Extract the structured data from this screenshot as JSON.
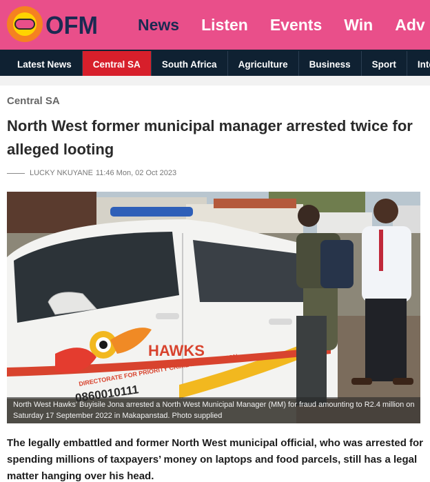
{
  "brand": {
    "logo_text": "OFM",
    "colors": {
      "header_pink": "#e94f8a",
      "nav_dark": "#0f2132",
      "active_red": "#d71f2b",
      "logo_orange": "#f58220"
    }
  },
  "top_nav": {
    "items": [
      "News",
      "Listen",
      "Events",
      "Win",
      "Adv"
    ],
    "active": "News"
  },
  "category_nav": {
    "items": [
      "Latest News",
      "Central SA",
      "South Africa",
      "Agriculture",
      "Business",
      "Sport",
      "Intern"
    ],
    "active": "Central SA"
  },
  "article": {
    "section": "Central SA",
    "title": "North West former municipal manager arrested twice for alleged looting",
    "author": "LUCKY NKUYANE",
    "timestamp": "11:46 Mon, 02 Oct 2023",
    "image": {
      "vehicle_text": "HAWKS",
      "vehicle_subtext": "DIRECTORATE FOR PRIORITY CRIME INVESTIGATION",
      "vehicle_phone": "0860010111",
      "caption": "North West Hawks' Buyisile Jona arrested a North West Municipal Manager (MM) for fraud amounting to R2.4 million on Saturday 17 September 2022 in Makapanstad. Photo supplied"
    },
    "lead": "The legally embattled and former North West municipal official, who was arrested for spending millions of taxpayers’ money on laptops and food parcels, still has a legal matter hanging over his head."
  }
}
